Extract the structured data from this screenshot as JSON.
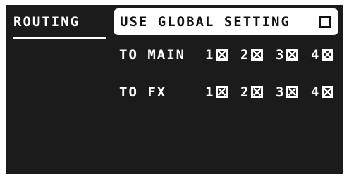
{
  "tab": {
    "label": "ROUTING"
  },
  "global_setting": {
    "label": "USE GLOBAL SETTING",
    "checked": false
  },
  "routes": [
    {
      "label": "TO MAIN",
      "channels": [
        {
          "number": "1",
          "checked": true
        },
        {
          "number": "2",
          "checked": true
        },
        {
          "number": "3",
          "checked": true
        },
        {
          "number": "4",
          "checked": true
        }
      ]
    },
    {
      "label": "TO FX",
      "channels": [
        {
          "number": "1",
          "checked": true
        },
        {
          "number": "2",
          "checked": true
        },
        {
          "number": "3",
          "checked": true
        },
        {
          "number": "4",
          "checked": true
        }
      ]
    }
  ],
  "colors": {
    "background": "#1b1b1b",
    "foreground": "#ffffff",
    "highlight_text": "#111111"
  }
}
